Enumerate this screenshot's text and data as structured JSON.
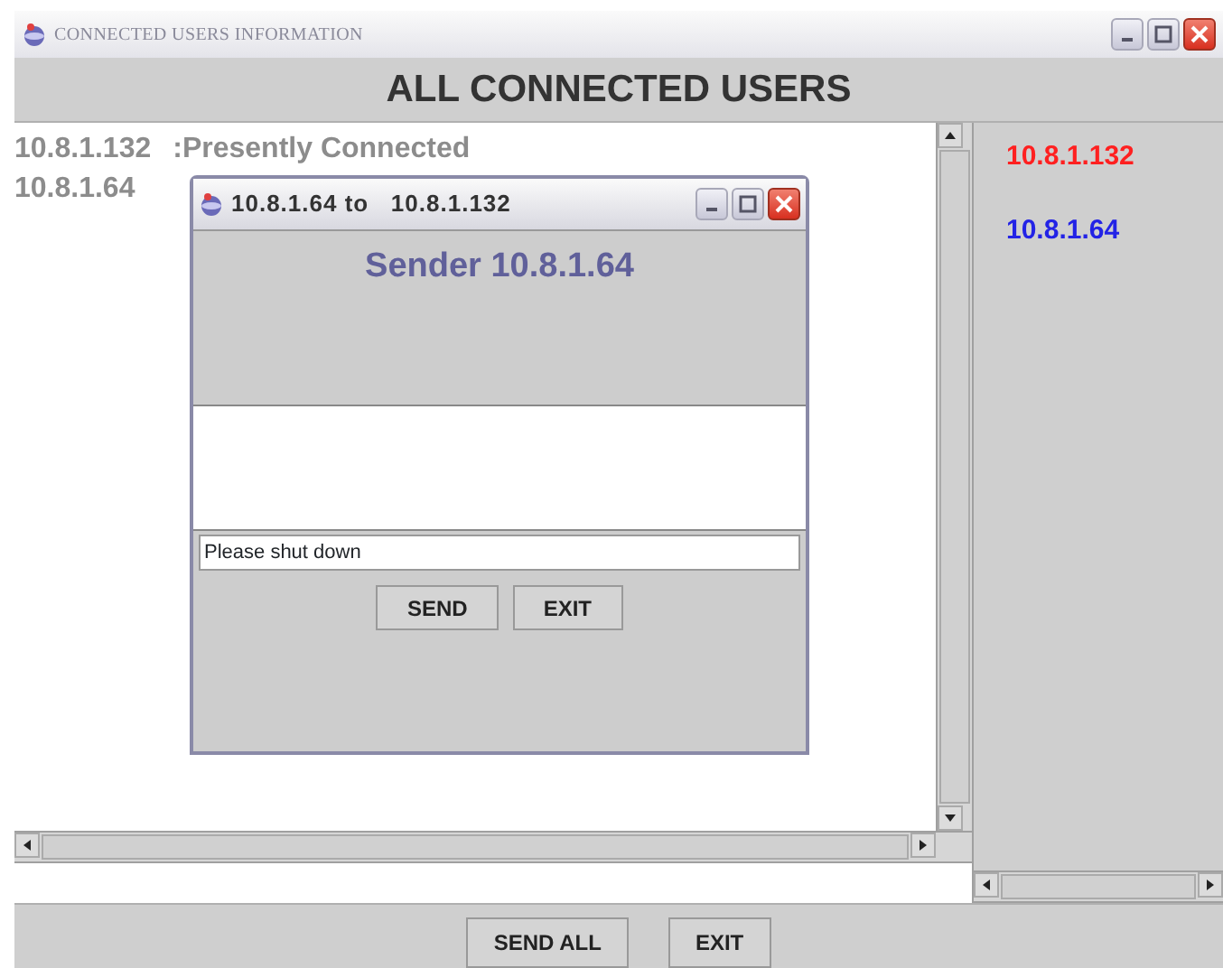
{
  "main_window": {
    "title": "CONNECTED USERS INFORMATION",
    "heading": "ALL CONNECTED USERS",
    "log_lines": [
      {
        "ip": "10.8.1.132",
        "status": ":Presently Connected"
      },
      {
        "ip": "10.8.1.64"
      }
    ],
    "users": [
      {
        "ip": "10.8.1.132",
        "color": "#ff2020"
      },
      {
        "ip": "10.8.1.64",
        "color": "#2323e6"
      }
    ],
    "buttons": [
      "SEND ALL",
      "EXIT"
    ]
  },
  "dialog": {
    "title": "10.8.1.64 to",
    "title_target": "10.8.1.132",
    "heading": "Sender 10.8.1.64",
    "message": {
      "value": "Please shut down"
    },
    "buttons": [
      "SEND",
      "EXIT"
    ]
  }
}
